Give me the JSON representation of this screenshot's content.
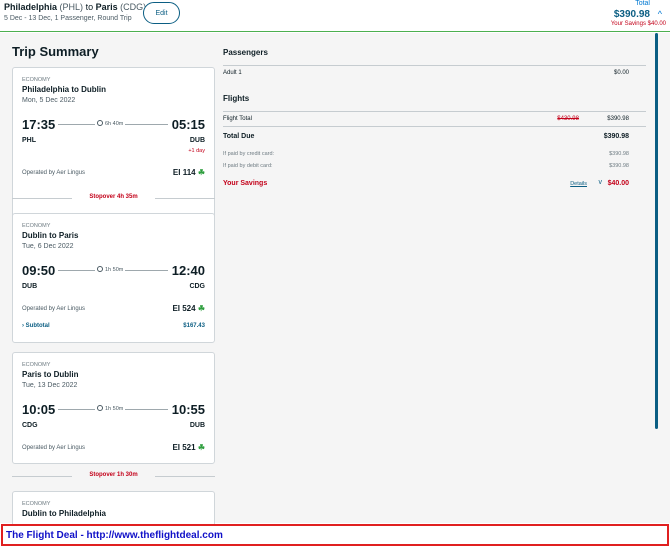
{
  "header": {
    "origin_city": "Philadelphia",
    "origin_code": "(PHL)",
    "to_word": "to",
    "dest_city": "Paris",
    "dest_code": "(CDG)",
    "subline": "5 Dec - 13 Dec, 1 Passenger, Round Trip",
    "edit_label": "Edit",
    "total_label": "Total",
    "total_price": "$390.98",
    "savings": "Your Savings $40.00",
    "caret_icon": "chevron-up-icon"
  },
  "summary": {
    "title": "Trip Summary"
  },
  "cards": [
    {
      "class": "ECONOMY",
      "route": "Philadelphia to Dublin",
      "date": "Mon, 5 Dec 2022",
      "dep_time": "17:35",
      "duration": "6h 40m",
      "arr_time": "05:15",
      "from": "PHL",
      "to": "DUB",
      "plus_day": "+1 day",
      "operated": "Operated by Aer Lingus",
      "flight": "EI 114"
    },
    {
      "class": "ECONOMY",
      "route": "Dublin to Paris",
      "date": "Tue, 6 Dec 2022",
      "dep_time": "09:50",
      "duration": "1h 50m",
      "arr_time": "12:40",
      "from": "DUB",
      "to": "CDG",
      "operated": "Operated by Aer Lingus",
      "flight": "EI 524",
      "subtotal_label": "Subtotal",
      "subtotal_value": "$167.43"
    },
    {
      "class": "ECONOMY",
      "route": "Paris to Dublin",
      "date": "Tue, 13 Dec 2022",
      "dep_time": "10:05",
      "duration": "1h 50m",
      "arr_time": "10:55",
      "from": "CDG",
      "to": "DUB",
      "operated": "Operated by Aer Lingus",
      "flight": "EI 521"
    },
    {
      "class": "ECONOMY",
      "route": "Dublin to Philadelphia"
    }
  ],
  "stopovers": [
    "Stopover 4h 35m",
    "Stopover 1h 30m"
  ],
  "passengers": {
    "title": "Passengers",
    "rows": [
      {
        "label": "Adult 1",
        "value": "$0.00"
      }
    ]
  },
  "flights": {
    "title": "Flights",
    "flight_total_label": "Flight Total",
    "flight_total_old": "$430.98",
    "flight_total_new": "$390.98",
    "total_due_label": "Total Due",
    "total_due_value": "$390.98",
    "credit_label": "If paid by credit card:",
    "credit_value": "$390.98",
    "debit_label": "If paid by debit card:",
    "debit_value": "$390.98",
    "savings_label": "Your Savings",
    "details_label": "Details",
    "savings_value": "$40.00"
  },
  "banner": {
    "text": "The Flight Deal - http://www.theflightdeal.com"
  },
  "colors": {
    "accent": "#0b5e83",
    "savings_red": "#c30019",
    "banner_blue": "#1010c8",
    "banner_border": "#e02020",
    "header_line": "#4caf50"
  }
}
